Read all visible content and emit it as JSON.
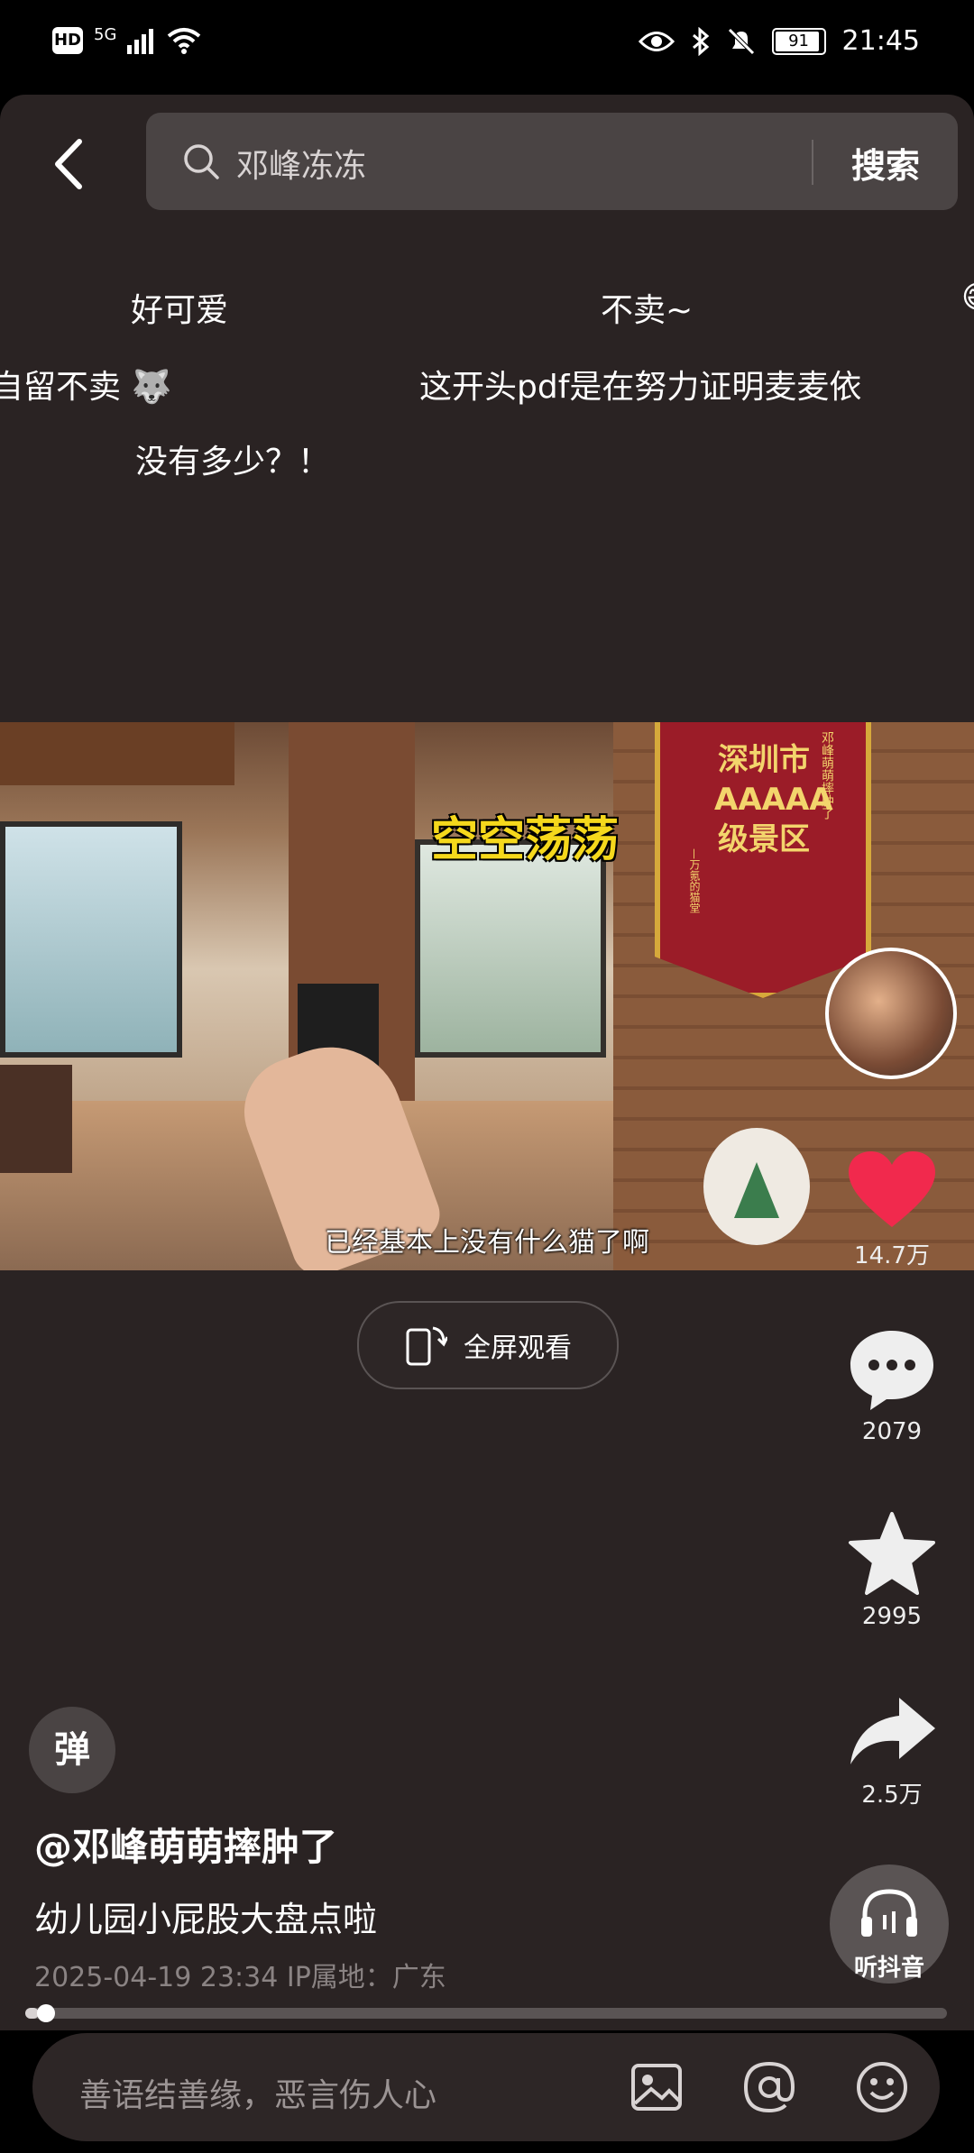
{
  "status_bar": {
    "network": "5G",
    "hd": "HD",
    "battery": "91",
    "time": "21:45"
  },
  "search": {
    "query": "邓峰冻冻",
    "button_label": "搜索"
  },
  "danmaku": [
    {
      "text": "好可爱"
    },
    {
      "text": "不卖~"
    },
    {
      "text": "自留不卖"
    },
    {
      "text": "这开头pdf是在努力证明麦麦依"
    },
    {
      "text": "没有多少？！"
    }
  ],
  "video": {
    "caption_top": "空空荡荡",
    "subtitle": "已经基本上没有什么猫了啊",
    "banner_text": "深圳市AAAAA级景区",
    "banner_side": "邓峰萌萌摔肿了",
    "banner_side2": "—万氪的猫堂"
  },
  "actions": {
    "likes": "14.7万",
    "comments": "2079",
    "favorites": "2995",
    "shares": "2.5万"
  },
  "fullscreen_label": "全屏观看",
  "danmaku_toggle": "弹",
  "post": {
    "author": "@邓峰萌萌摔肿了",
    "description": "幼儿园小屁股大盘点啦",
    "meta": "2025-04-19 23:34 IP属地：广东"
  },
  "listen_label": "听抖音",
  "progress": 0.015,
  "comment_placeholder": "善语结善缘，恶言伤人心",
  "colors": {
    "background": "#2a2323",
    "like": "#f1294d",
    "caption": "#f5d81c"
  }
}
